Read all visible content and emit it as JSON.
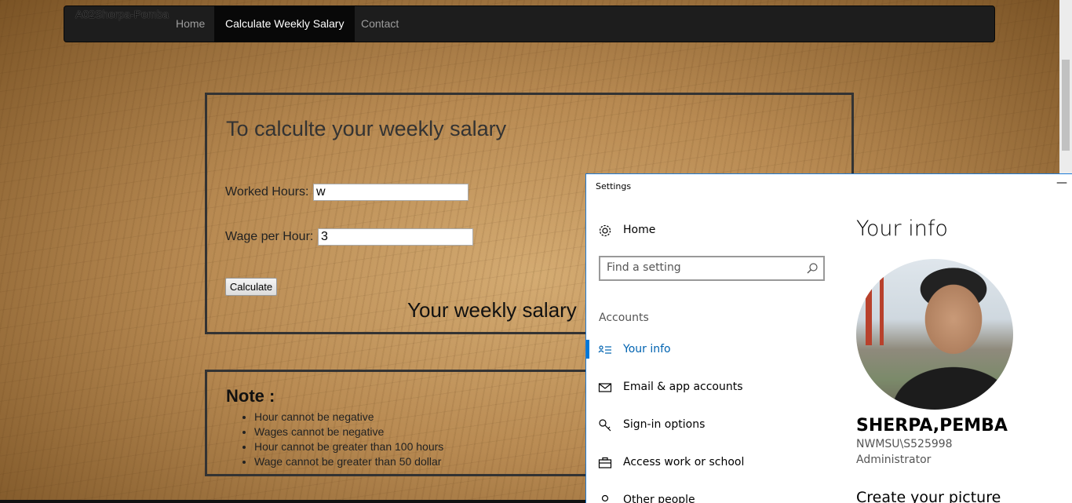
{
  "navbar": {
    "brand": "A02Sherpa-Pemba",
    "items": [
      {
        "label": "Home"
      },
      {
        "label": "Calculate Weekly Salary"
      },
      {
        "label": "Contact"
      }
    ]
  },
  "calc": {
    "title": "To calculte your weekly salary",
    "hours_label": "Worked Hours:",
    "hours_value": "w",
    "wage_label": "Wage per Hour:",
    "wage_value": "3",
    "button_label": "Calculate",
    "result_text": "Your weekly salary"
  },
  "note": {
    "title": "Note :",
    "items": [
      "Hour cannot be negative",
      "Wages cannot be negative",
      "Hour cannot be greater than 100 hours",
      "Wage cannot be greater than 50 dollar"
    ]
  },
  "settings": {
    "window_title": "Settings",
    "minimize_glyph": "—",
    "home_label": "Home",
    "search_placeholder": "Find a setting",
    "section_label": "Accounts",
    "nav": [
      {
        "label": "Your info",
        "icon": "person-card-icon"
      },
      {
        "label": "Email & app accounts",
        "icon": "mail-icon"
      },
      {
        "label": "Sign-in options",
        "icon": "key-icon"
      },
      {
        "label": "Access work or school",
        "icon": "briefcase-icon"
      },
      {
        "label": "Other people",
        "icon": "person-icon"
      }
    ],
    "page_heading": "Your info",
    "user_name": "SHERPA,PEMBA",
    "user_id": "NWMSU\\S525998",
    "user_role": "Administrator",
    "create_picture": "Create your picture",
    "accent_color": "#0078d7"
  }
}
